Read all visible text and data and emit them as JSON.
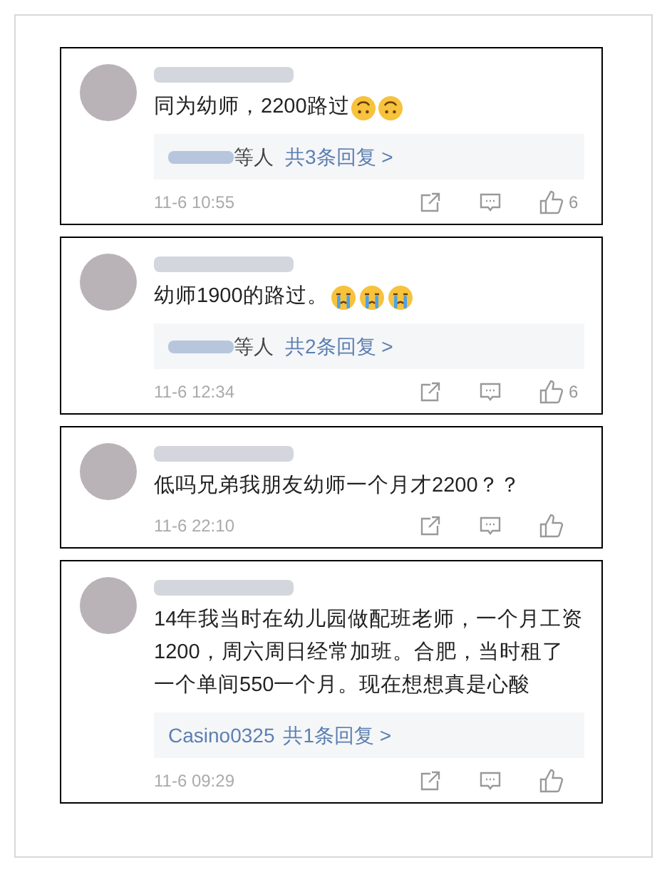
{
  "comments": [
    {
      "text": "同为幼师，2200路过",
      "emojis": [
        {
          "kind": "upside-down"
        },
        {
          "kind": "upside-down"
        }
      ],
      "reply_preview": {
        "prefix": "等人",
        "link": "共3条回复 >"
      },
      "time": "11-6 10:55",
      "likes": "6"
    },
    {
      "text": "幼师1900的路过。",
      "emojis": [
        {
          "kind": "crying"
        },
        {
          "kind": "crying"
        },
        {
          "kind": "crying"
        }
      ],
      "reply_preview": {
        "prefix": "等人",
        "link": "共2条回复 >"
      },
      "time": "11-6 12:34",
      "likes": "6"
    },
    {
      "text": "低吗兄弟我朋友幼师一个月才2200？？",
      "time": "11-6 22:10"
    },
    {
      "text": "14年我当时在幼儿园做配班老师，一个月工资1200，周六周日经常加班。合肥，当时租了一个单间550一个月。现在想想真是心酸",
      "reply_preview": {
        "author": "Casino0325",
        "link": "共1条回复 >"
      },
      "time": "11-6 09:29"
    }
  ]
}
